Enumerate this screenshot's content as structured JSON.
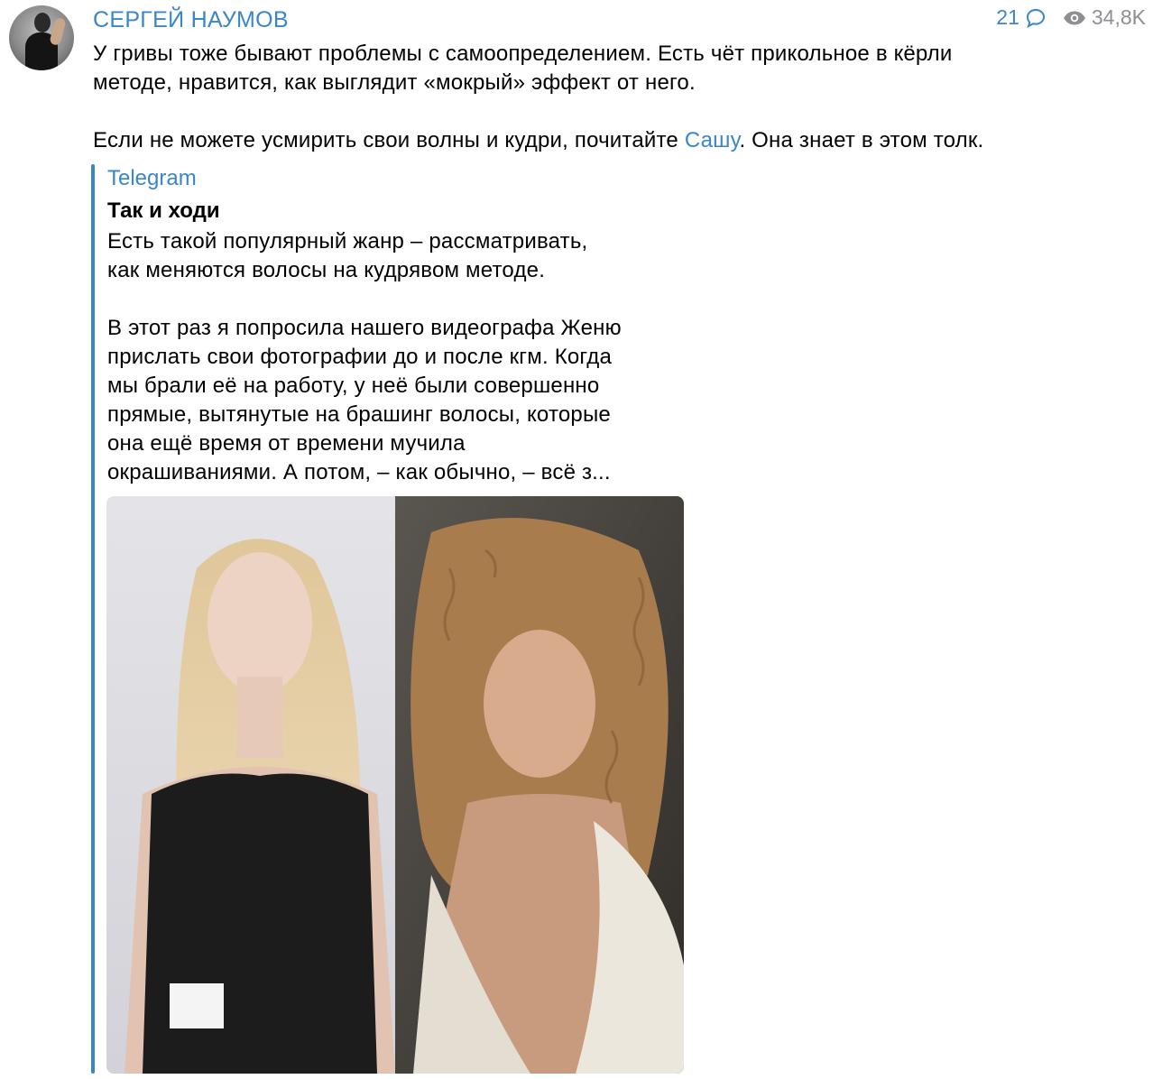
{
  "author": {
    "name": "СЕРГЕЙ НАУМОВ",
    "avatar_icon": "avatar-photo"
  },
  "meta": {
    "comments": "21",
    "views": "34,8K",
    "accent_color": "#3a86c8",
    "muted_color": "#8e8e93"
  },
  "post": {
    "line1": "У гривы тоже бывают проблемы с самоопределением. Есть чёт прикольное в кёрли",
    "line2": "методе, нравится, как выглядит  «мокрый» эффект от него.",
    "line3_before": "Если не можете усмирить свои волны и кудри, почитайте ",
    "line3_link": "Сашу",
    "line3_after": ". Она знает в этом толк."
  },
  "quote": {
    "source": "Telegram",
    "title": "Так и ходи",
    "p1_line1": "Есть такой популярный жанр – рассматривать,",
    "p1_line2": "как меняются волосы на кудрявом методе.",
    "p2_line1": "В этот раз я попросила нашего видеографа Женю",
    "p2_line2": "прислать свои фотографии до и после кгм. Когда",
    "p2_line3": "мы брали её на работу, у неё были совершенно",
    "p2_line4": "прямые, вытянутые на брашинг волосы, которые",
    "p2_line5": "она ещё время от времени мучила",
    "p2_line6": "окрашиваниями. А потом, – как обычно, – всё з..."
  }
}
